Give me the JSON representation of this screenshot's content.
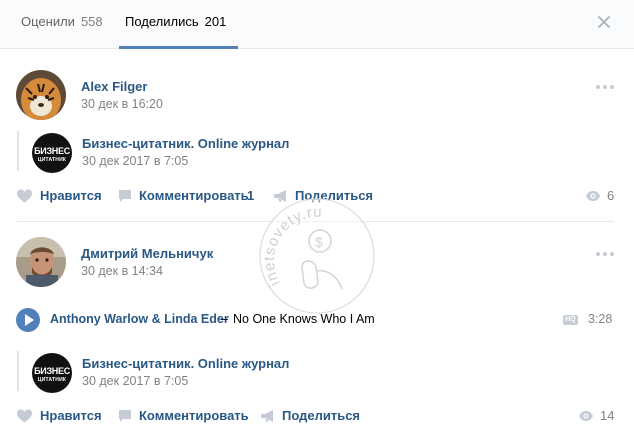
{
  "tabs": [
    {
      "label": "Оценили",
      "count": "558"
    },
    {
      "label": "Поделились",
      "count": "201"
    }
  ],
  "posts": [
    {
      "author": "Alex Filger",
      "date": "30 дек в 16:20",
      "repost": {
        "logo_line1": "БИЗНЕС",
        "logo_line2": "ЦИТАТНИК",
        "source": "Бизнес-цитатник. Online журнал",
        "date": "30 дек 2017 в 7:05"
      },
      "actions": {
        "like": "Нравится",
        "comment": "Комментировать",
        "comment_count": "1",
        "share": "Поделиться",
        "views": "6"
      }
    },
    {
      "author": "Дмитрий Мельничук",
      "date": "30 дек в 14:34",
      "audio": {
        "artist": "Anthony Warlow & Linda Eder",
        "separator": "–",
        "title": "No One Knows Who I Am",
        "quality_badge": "HQ",
        "duration": "3:28"
      },
      "repost": {
        "logo_line1": "БИЗНЕС",
        "logo_line2": "ЦИТАТНИК",
        "source": "Бизнес-цитатник. Online журнал",
        "date": "30 дек 2017 в 7:05"
      },
      "actions": {
        "like": "Нравится",
        "comment": "Комментировать",
        "share": "Поделиться",
        "views": "14"
      }
    }
  ],
  "watermark": "inetsovety.ru",
  "colors": {
    "link": "#2a5885",
    "accent": "#5181b8",
    "muted": "#828282",
    "icon": "#c5ccd5"
  }
}
